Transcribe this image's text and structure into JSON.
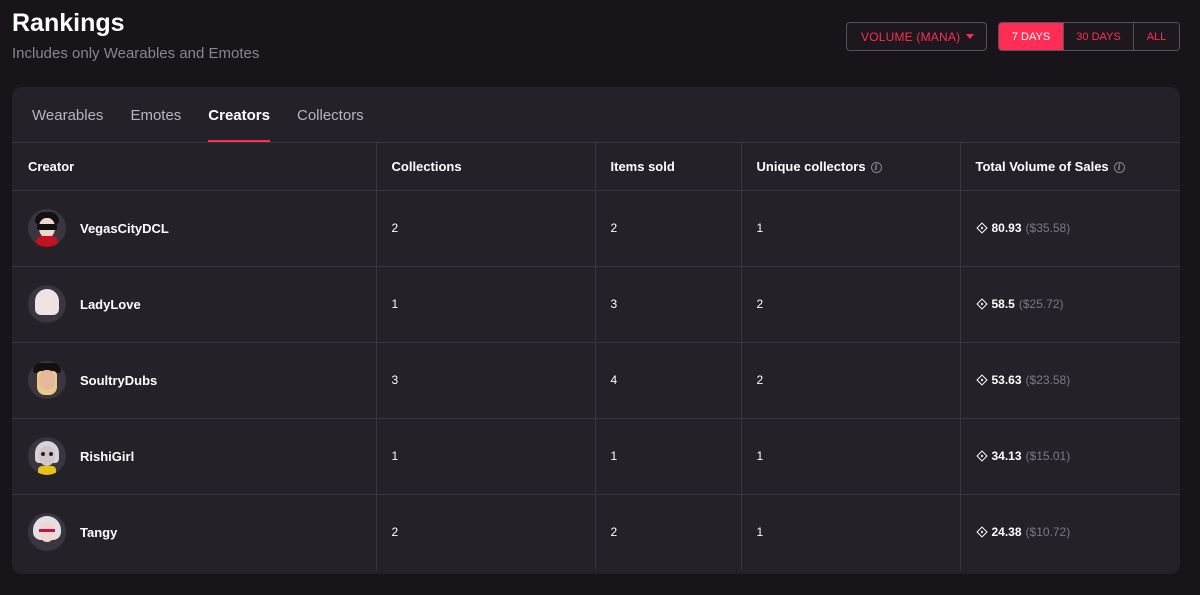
{
  "header": {
    "title": "Rankings",
    "subtitle": "Includes only Wearables and Emotes"
  },
  "controls": {
    "sort_select": "VOLUME (MANA)",
    "ranges": [
      "7 DAYS",
      "30 DAYS",
      "ALL"
    ],
    "active_range": "7 DAYS"
  },
  "tabs": [
    "Wearables",
    "Emotes",
    "Creators",
    "Collectors"
  ],
  "active_tab": "Creators",
  "table": {
    "columns": [
      "Creator",
      "Collections",
      "Items sold",
      "Unique collectors",
      "Total Volume of Sales"
    ],
    "rows": [
      {
        "creator": "VegasCityDCL",
        "collections": "2",
        "items_sold": "2",
        "unique_collectors": "1",
        "volume": "80.93",
        "usd": "($35.58)"
      },
      {
        "creator": "LadyLove",
        "collections": "1",
        "items_sold": "3",
        "unique_collectors": "2",
        "volume": "58.5",
        "usd": "($25.72)"
      },
      {
        "creator": "SoultryDubs",
        "collections": "3",
        "items_sold": "4",
        "unique_collectors": "2",
        "volume": "53.63",
        "usd": "($23.58)"
      },
      {
        "creator": "RishiGirl",
        "collections": "1",
        "items_sold": "1",
        "unique_collectors": "1",
        "volume": "34.13",
        "usd": "($15.01)"
      },
      {
        "creator": "Tangy",
        "collections": "2",
        "items_sold": "2",
        "unique_collectors": "1",
        "volume": "24.38",
        "usd": "($10.72)"
      }
    ]
  },
  "colors": {
    "accent": "#ff2d55",
    "background": "#18141a",
    "card": "#242129"
  },
  "icons": {
    "sort_caret": "caret-down-icon",
    "info": "info-icon",
    "currency": "mana-icon"
  }
}
